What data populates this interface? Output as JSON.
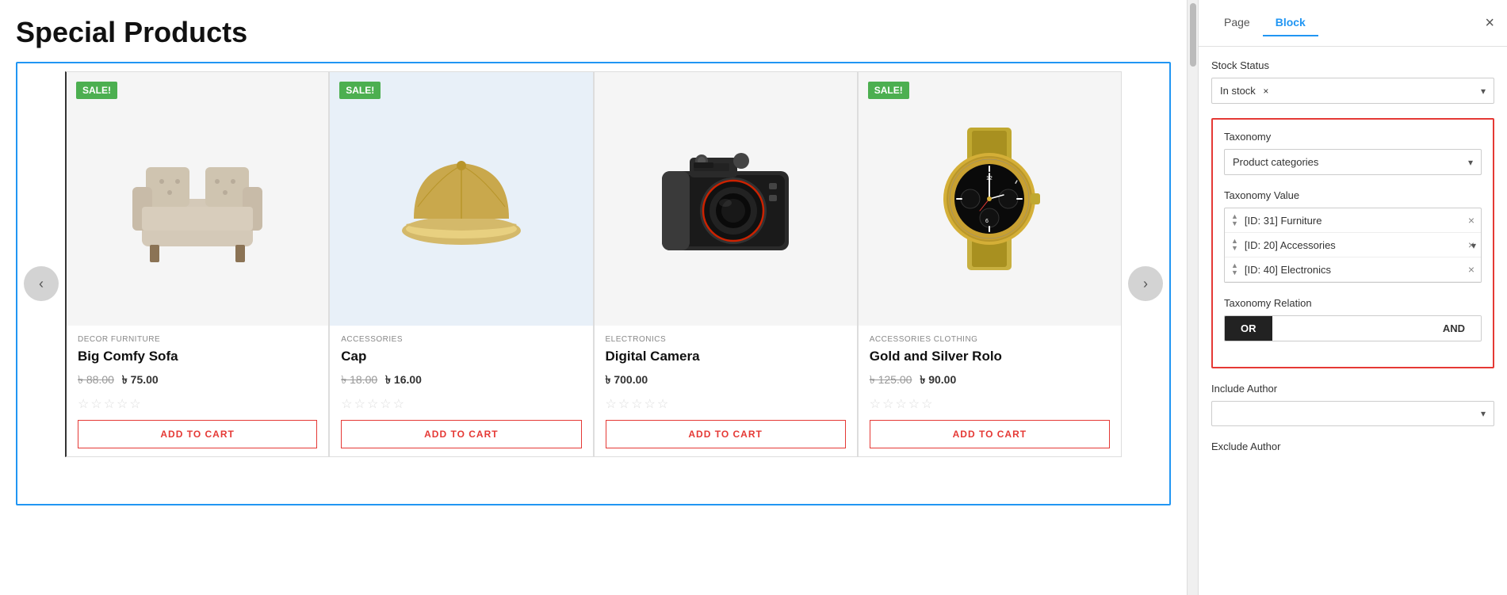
{
  "page": {
    "title": "Special Products"
  },
  "carousel": {
    "prev_label": "‹",
    "next_label": "›"
  },
  "products": [
    {
      "id": 1,
      "sale": true,
      "sale_label": "SALE!",
      "categories": "DECOR  FURNITURE",
      "name": "Big Comfy Sofa",
      "price_original": "৳ 88.00",
      "price_sale": "৳ 75.00",
      "has_sale_price": true,
      "add_to_cart": "ADD TO CART",
      "image_type": "sofa"
    },
    {
      "id": 2,
      "sale": true,
      "sale_label": "SALE!",
      "categories": "ACCESSORIES",
      "name": "Cap",
      "price_original": "৳ 18.00",
      "price_sale": "৳ 16.00",
      "has_sale_price": true,
      "add_to_cart": "ADD TO CART",
      "image_type": "cap"
    },
    {
      "id": 3,
      "sale": false,
      "categories": "ELECTRONICS",
      "name": "Digital Camera",
      "price_original": "",
      "price_sale": "৳ 700.00",
      "has_sale_price": false,
      "add_to_cart": "ADD TO CART",
      "image_type": "camera"
    },
    {
      "id": 4,
      "sale": true,
      "sale_label": "SALE!",
      "categories": "ACCESSORIES  CLOTHING",
      "name": "Gold and Silver Rolo",
      "price_original": "৳ 125.00",
      "price_sale": "৳ 90.00",
      "has_sale_price": true,
      "add_to_cart": "ADD TO CART",
      "image_type": "watch"
    }
  ],
  "panel": {
    "tabs": [
      "Page",
      "Block"
    ],
    "active_tab": "Block",
    "close_icon": "×",
    "stock_status_label": "Stock Status",
    "stock_tag": "In stock",
    "stock_remove": "×",
    "stock_chevron": "▾",
    "taxonomy_label": "Taxonomy",
    "taxonomy_value": "Product categories",
    "taxonomy_chevron": "▾",
    "taxonomy_value_label": "Taxonomy Value",
    "taxonomy_items": [
      {
        "id": "ID: 31",
        "name": "Furniture"
      },
      {
        "id": "ID: 20",
        "name": "Accessories"
      },
      {
        "id": "ID: 40",
        "name": "Electronics"
      }
    ],
    "taxonomy_relation_label": "Taxonomy Relation",
    "relation_or": "OR",
    "relation_and": "AND",
    "include_author_label": "Include Author",
    "exclude_author_label": "Exclude Author"
  }
}
